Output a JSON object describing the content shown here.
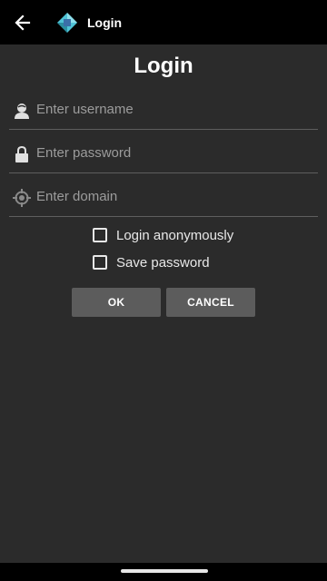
{
  "appbar": {
    "title": "Login",
    "back_icon": "arrow-left-icon",
    "logo_icon": "app-logo-icon"
  },
  "page": {
    "title": "Login"
  },
  "form": {
    "username": {
      "placeholder": "Enter username",
      "value": "",
      "icon": "user-icon"
    },
    "password": {
      "placeholder": "Enter password",
      "value": "",
      "icon": "lock-icon"
    },
    "domain": {
      "placeholder": "Enter domain",
      "value": "",
      "icon": "crosshair-icon"
    },
    "login_anonymously": {
      "label": "Login anonymously",
      "checked": false
    },
    "save_password": {
      "label": "Save password",
      "checked": false
    }
  },
  "buttons": {
    "ok": "OK",
    "cancel": "CANCEL"
  },
  "colors": {
    "background": "#2b2b2b",
    "appbar": "#000000",
    "button": "#5c5c5c",
    "logo_cyan": "#4fc3d6"
  }
}
